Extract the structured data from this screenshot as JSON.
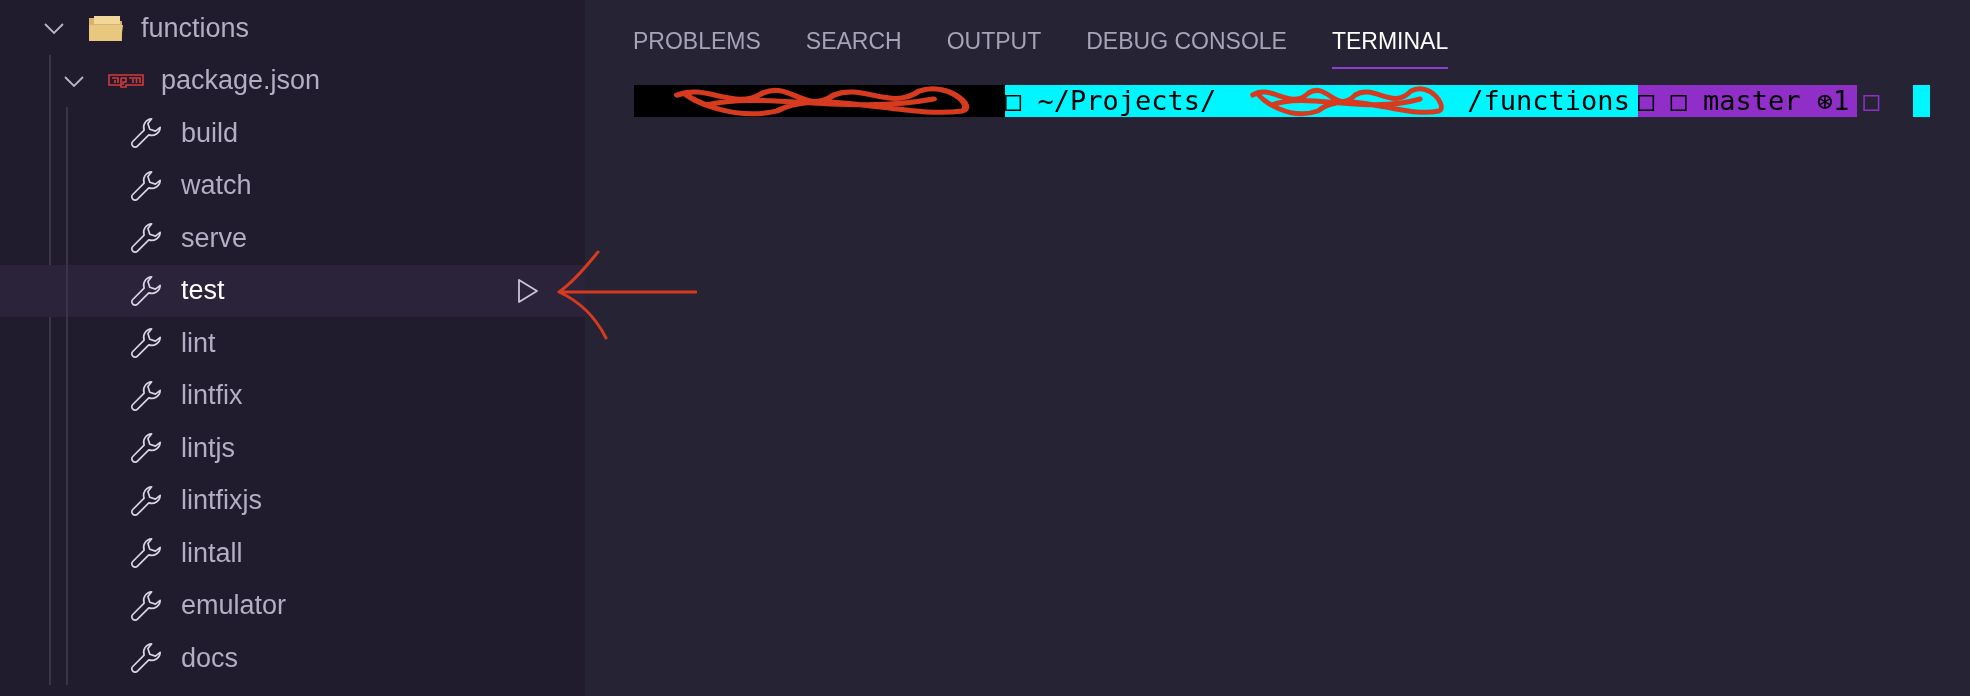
{
  "sidebar": {
    "tree": [
      {
        "label": "functions",
        "kind": "folder",
        "expanded": true,
        "children": [
          {
            "label": "package.json",
            "kind": "npm",
            "expanded": true,
            "children": [
              {
                "label": "build",
                "kind": "script",
                "hovered": false
              },
              {
                "label": "watch",
                "kind": "script",
                "hovered": false
              },
              {
                "label": "serve",
                "kind": "script",
                "hovered": false
              },
              {
                "label": "test",
                "kind": "script",
                "hovered": true
              },
              {
                "label": "lint",
                "kind": "script",
                "hovered": false
              },
              {
                "label": "lintfix",
                "kind": "script",
                "hovered": false
              },
              {
                "label": "lintjs",
                "kind": "script",
                "hovered": false
              },
              {
                "label": "lintfixjs",
                "kind": "script",
                "hovered": false
              },
              {
                "label": "lintall",
                "kind": "script",
                "hovered": false
              },
              {
                "label": "emulator",
                "kind": "script",
                "hovered": false
              },
              {
                "label": "docs",
                "kind": "script",
                "hovered": false
              }
            ]
          }
        ]
      }
    ]
  },
  "panel": {
    "tabs": [
      {
        "label": "PROBLEMS",
        "selected": false
      },
      {
        "label": "SEARCH",
        "selected": false
      },
      {
        "label": "OUTPUT",
        "selected": false
      },
      {
        "label": "DEBUG CONSOLE",
        "selected": false
      },
      {
        "label": "TERMINAL",
        "selected": true
      }
    ],
    "terminal": {
      "segments": [
        {
          "kind": "redacted",
          "color": "#000000"
        },
        {
          "kind": "text",
          "text": "□ ~/Projects/",
          "color": "#00f6ff"
        },
        {
          "kind": "redacted",
          "color": "#00f6ff"
        },
        {
          "kind": "text",
          "text": "/functions",
          "color": "#00f6ff"
        },
        {
          "kind": "text",
          "text": "□ □ master ⊛1",
          "color": "#8f2fc8"
        },
        {
          "kind": "glyph",
          "text": "□",
          "color": "#8f2fc8"
        },
        {
          "kind": "cursor",
          "color": "#00f6ff"
        }
      ]
    }
  }
}
